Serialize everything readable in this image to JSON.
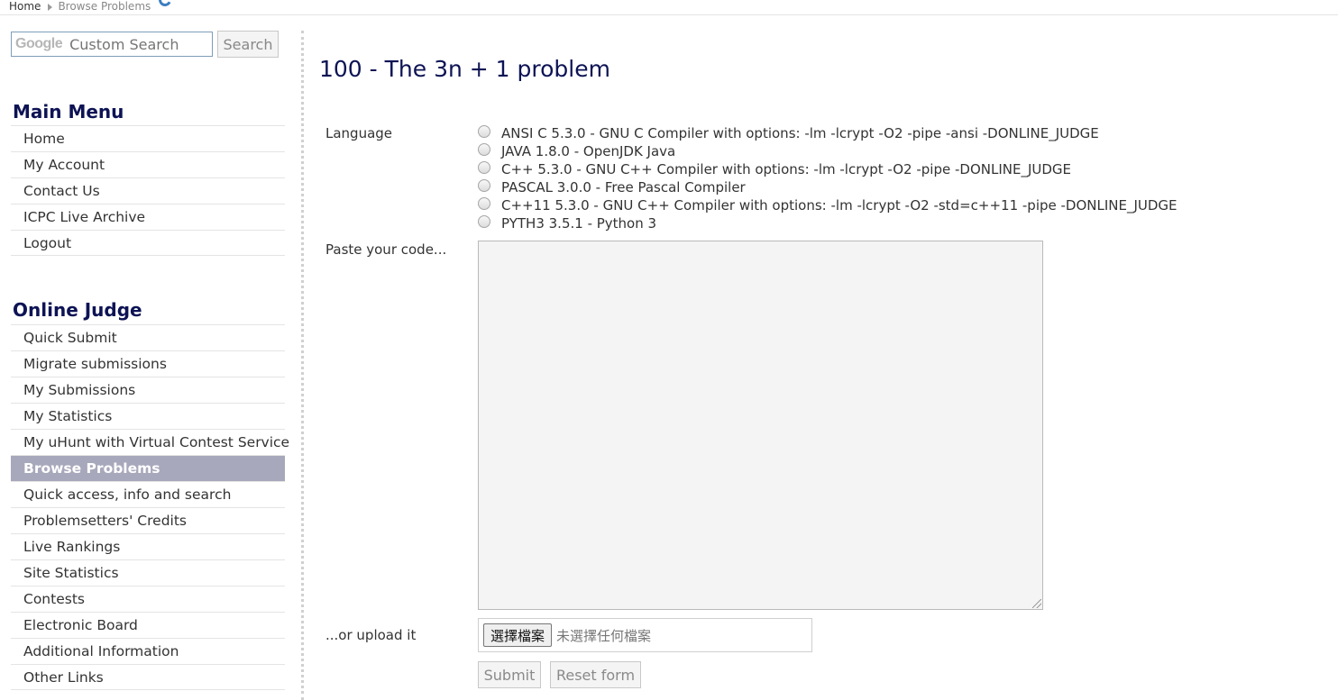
{
  "breadcrumb": {
    "home": "Home",
    "current": "Browse Problems"
  },
  "search": {
    "brand": "Google",
    "placeholder": "Custom Search",
    "button_label": "Search"
  },
  "main_menu": {
    "title": "Main Menu",
    "items": [
      "Home",
      "My Account",
      "Contact Us",
      "ICPC Live Archive",
      "Logout"
    ]
  },
  "online_judge": {
    "title": "Online Judge",
    "active": "Browse Problems",
    "items": [
      "Quick Submit",
      "Migrate submissions",
      "My Submissions",
      "My Statistics",
      "My uHunt with Virtual Contest Service",
      "Browse Problems",
      "Quick access, info and search",
      "Problemsetters' Credits",
      "Live Rankings",
      "Site Statistics",
      "Contests",
      "Electronic Board",
      "Additional Information",
      "Other Links"
    ]
  },
  "problem": {
    "title": "100 - The 3n + 1 problem"
  },
  "form": {
    "language_label": "Language",
    "languages": [
      "ANSI C 5.3.0 - GNU C Compiler with options: -lm -lcrypt -O2 -pipe -ansi -DONLINE_JUDGE",
      "JAVA 1.8.0 - OpenJDK Java",
      "C++ 5.3.0 - GNU C++ Compiler with options: -lm -lcrypt -O2 -pipe -DONLINE_JUDGE",
      "PASCAL 3.0.0 - Free Pascal Compiler",
      "C++11 5.3.0 - GNU C++ Compiler with options: -lm -lcrypt -O2 -std=c++11 -pipe -DONLINE_JUDGE",
      "PYTH3 3.5.1 - Python 3"
    ],
    "code_label": "Paste your code...",
    "code_value": "",
    "upload_label": "...or upload it",
    "choose_file_label": "選擇檔案",
    "no_file_text": "未選擇任何檔案",
    "submit_label": "Submit",
    "reset_label": "Reset form"
  },
  "colors": {
    "heading": "#0d1354",
    "active_menu_bg": "#a8a8bc",
    "text": "#333333"
  }
}
